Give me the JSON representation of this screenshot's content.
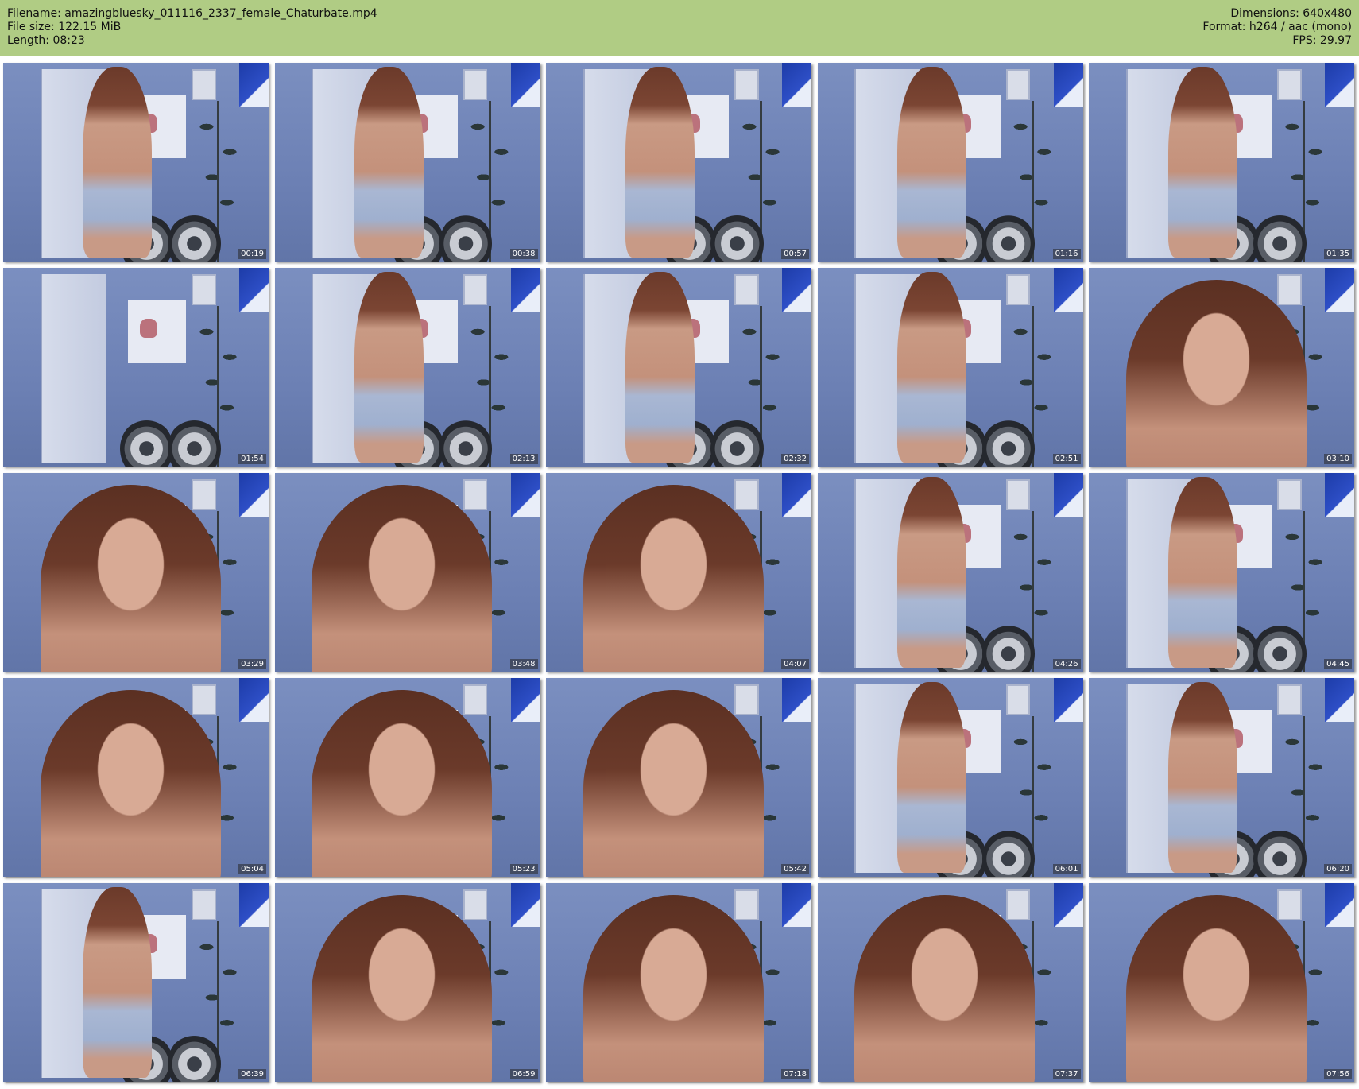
{
  "header": {
    "filename_line": "Filename: amazingbluesky_011116_2337_female_Chaturbate.mp4",
    "filesize_line": "File size: 122.15 MiB",
    "length_line": "Length: 08:23",
    "dimensions_line": "Dimensions: 640x480",
    "format_line": "Format: h264 / aac (mono)",
    "fps_line": "FPS: 29.97",
    "background_color": "#b0cc84"
  },
  "thumbnails": [
    {
      "time": "00:19",
      "view": "wide"
    },
    {
      "time": "00:38",
      "view": "wide"
    },
    {
      "time": "00:57",
      "view": "wide"
    },
    {
      "time": "01:16",
      "view": "wide"
    },
    {
      "time": "01:35",
      "view": "wide"
    },
    {
      "time": "01:54",
      "view": "empty"
    },
    {
      "time": "02:13",
      "view": "wide"
    },
    {
      "time": "02:32",
      "view": "wide"
    },
    {
      "time": "02:51",
      "view": "wide"
    },
    {
      "time": "03:10",
      "view": "close"
    },
    {
      "time": "03:29",
      "view": "close"
    },
    {
      "time": "03:48",
      "view": "close"
    },
    {
      "time": "04:07",
      "view": "close"
    },
    {
      "time": "04:26",
      "view": "wide"
    },
    {
      "time": "04:45",
      "view": "wide"
    },
    {
      "time": "05:04",
      "view": "close"
    },
    {
      "time": "05:23",
      "view": "close"
    },
    {
      "time": "05:42",
      "view": "close"
    },
    {
      "time": "06:01",
      "view": "wide"
    },
    {
      "time": "06:20",
      "view": "wide"
    },
    {
      "time": "06:39",
      "view": "wide"
    },
    {
      "time": "06:59",
      "view": "close"
    },
    {
      "time": "07:18",
      "view": "close"
    },
    {
      "time": "07:37",
      "view": "close"
    },
    {
      "time": "07:56",
      "view": "close"
    }
  ]
}
